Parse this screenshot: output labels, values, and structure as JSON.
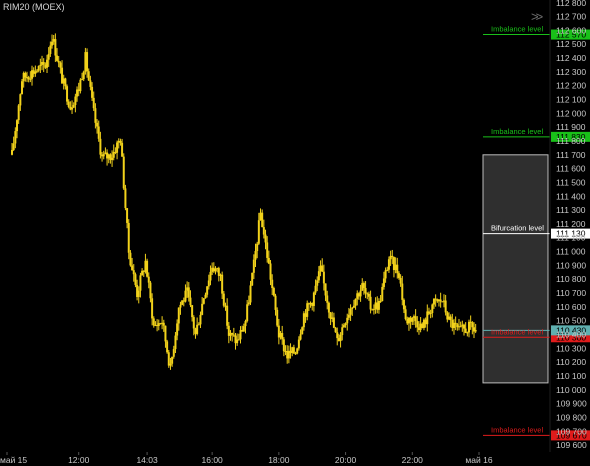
{
  "header": {
    "symbol": "RIM20 (MOEX)",
    "collapse_icon": "double-chevron-right-icon"
  },
  "colors": {
    "background": "#000000",
    "candle": "#f2d21b",
    "axis_text": "#c8c8c8",
    "imbalance_up": "#19c019",
    "imbalance_down": "#e01b1b",
    "bifurcation": "#ffffff",
    "zone_fill": "#555555",
    "last_price_line": "#5fb0b0"
  },
  "chart_data": {
    "type": "candlestick",
    "instrument": "RIM20 (MOEX)",
    "y_axis": {
      "range": [
        109550,
        112820
      ],
      "ticks": [
        112800,
        112700,
        112600,
        112500,
        112400,
        112300,
        112200,
        112100,
        112000,
        111900,
        111800,
        111700,
        111600,
        111500,
        111400,
        111300,
        111200,
        111100,
        111000,
        110900,
        110800,
        110700,
        110600,
        110500,
        110400,
        110300,
        110200,
        110100,
        110000,
        109900,
        109800,
        109700,
        109600
      ]
    },
    "x_axis": {
      "labels": [
        {
          "text": "май 15",
          "hour": 9.85
        },
        {
          "text": "12:00",
          "hour": 12.0
        },
        {
          "text": "14:03",
          "hour": 14.05
        },
        {
          "text": "16:00",
          "hour": 16.0
        },
        {
          "text": "18:00",
          "hour": 18.0
        },
        {
          "text": "20:00",
          "hour": 20.0
        },
        {
          "text": "22:00",
          "hour": 22.0
        },
        {
          "text": "май 16",
          "hour": 24.0
        }
      ]
    },
    "price_path": [
      [
        10.0,
        111700
      ],
      [
        10.3,
        112250
      ],
      [
        10.6,
        112300
      ],
      [
        11.0,
        112350
      ],
      [
        11.2,
        112560
      ],
      [
        11.5,
        112250
      ],
      [
        11.75,
        112050
      ],
      [
        12.0,
        112180
      ],
      [
        12.2,
        112400
      ],
      [
        12.45,
        112000
      ],
      [
        12.7,
        111680
      ],
      [
        13.0,
        111700
      ],
      [
        13.25,
        111820
      ],
      [
        13.5,
        111000
      ],
      [
        13.75,
        110700
      ],
      [
        14.0,
        110930
      ],
      [
        14.25,
        110460
      ],
      [
        14.5,
        110500
      ],
      [
        14.75,
        110150
      ],
      [
        15.0,
        110600
      ],
      [
        15.25,
        110700
      ],
      [
        15.5,
        110400
      ],
      [
        15.75,
        110680
      ],
      [
        16.0,
        110900
      ],
      [
        16.25,
        110820
      ],
      [
        16.5,
        110400
      ],
      [
        16.75,
        110350
      ],
      [
        17.0,
        110500
      ],
      [
        17.25,
        110900
      ],
      [
        17.45,
        111280
      ],
      [
        17.7,
        110900
      ],
      [
        18.0,
        110400
      ],
      [
        18.25,
        110250
      ],
      [
        18.5,
        110280
      ],
      [
        18.75,
        110550
      ],
      [
        19.0,
        110650
      ],
      [
        19.25,
        110870
      ],
      [
        19.5,
        110600
      ],
      [
        19.75,
        110350
      ],
      [
        20.0,
        110520
      ],
      [
        20.25,
        110650
      ],
      [
        20.5,
        110750
      ],
      [
        20.75,
        110600
      ],
      [
        21.0,
        110620
      ],
      [
        21.3,
        110950
      ],
      [
        21.6,
        110850
      ],
      [
        21.8,
        110500
      ],
      [
        22.0,
        110530
      ],
      [
        22.3,
        110450
      ],
      [
        22.6,
        110620
      ],
      [
        22.9,
        110650
      ],
      [
        23.1,
        110500
      ],
      [
        23.4,
        110420
      ],
      [
        23.7,
        110450
      ],
      [
        23.95,
        110430
      ]
    ],
    "levels": [
      {
        "name": "Imbalance level",
        "price": 112570,
        "color_key": "imbalance_up",
        "label_value": "112 570"
      },
      {
        "name": "Imbalance level",
        "price": 111830,
        "color_key": "imbalance_up",
        "label_value": "111 830"
      },
      {
        "name": "Bifurcation level",
        "price": 111130,
        "color_key": "bifurcation",
        "label_value": "111 130"
      },
      {
        "name": "Imbalance level",
        "price": 110380,
        "color_key": "imbalance_down",
        "label_value": "110 380"
      },
      {
        "name": "Imbalance level",
        "price": 109670,
        "color_key": "imbalance_down",
        "label_value": "109 670"
      }
    ],
    "last_price": {
      "price": 110430,
      "label_value": "110 430"
    },
    "zone": {
      "price_top": 111700,
      "price_bottom": 110050
    }
  }
}
